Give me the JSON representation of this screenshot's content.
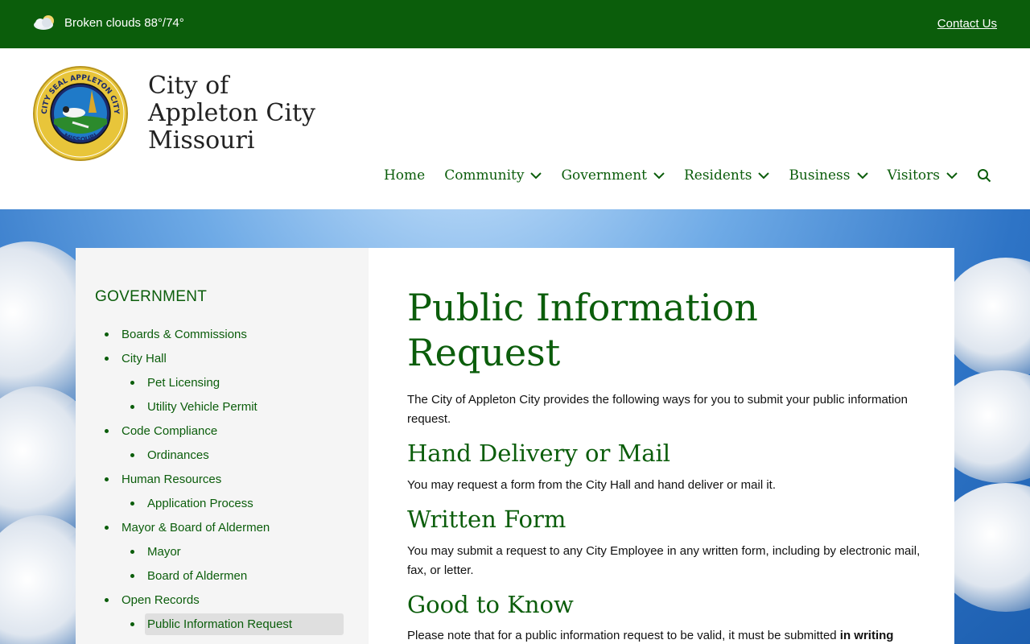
{
  "topbar": {
    "weather_text": "Broken clouds 88°/74°",
    "contact_label": "Contact Us",
    "weather_icon": "cloud-sun-icon",
    "background": "#0b5d0b"
  },
  "header": {
    "title_line1": "City of",
    "title_line2": "Appleton City",
    "title_line3": "Missouri",
    "seal_top_text": "CITY SEAL APPLETON CITY",
    "seal_bottom_text": "MISSOURI"
  },
  "nav": {
    "items": [
      {
        "label": "Home"
      },
      {
        "label": "Community"
      },
      {
        "label": "Government"
      },
      {
        "label": "Residents"
      },
      {
        "label": "Business"
      },
      {
        "label": "Visitors"
      }
    ],
    "search_icon": "search-icon"
  },
  "sidebar": {
    "heading": "GOVERNMENT",
    "items": [
      {
        "label": "Boards & Commissions"
      },
      {
        "label": "City Hall"
      },
      {
        "label": "Pet Licensing"
      },
      {
        "label": "Utility Vehicle Permit"
      },
      {
        "label": "Code Compliance"
      },
      {
        "label": "Ordinances"
      },
      {
        "label": "Human Resources"
      },
      {
        "label": "Application Process"
      },
      {
        "label": "Mayor & Board of Aldermen"
      },
      {
        "label": "Mayor"
      },
      {
        "label": "Board of Aldermen"
      },
      {
        "label": "Open Records"
      },
      {
        "label": "Public Information Request"
      }
    ]
  },
  "main": {
    "title_line1": "Public Information",
    "title_line2": "Request",
    "intro": "The City of Appleton City provides the following ways for you to submit your public information request.",
    "section1_heading": "Hand Delivery or Mail",
    "section1_text": "You may request a form from the City Hall and hand deliver or mail it.",
    "section2_heading": "Written Form",
    "section2_text": "You may submit a request to any City Employee in any written form, including by electronic mail, fax, or letter.",
    "section3_heading": "Good to Know",
    "section3_text_start": "Please note that for a public information request to be valid, it must be submitted ",
    "section3_text_bold": "in writing"
  },
  "colors": {
    "brand_green": "#0b5d0b",
    "sidebar_bg": "#f5f5f5",
    "active_item_bg": "#dfdfdf"
  }
}
